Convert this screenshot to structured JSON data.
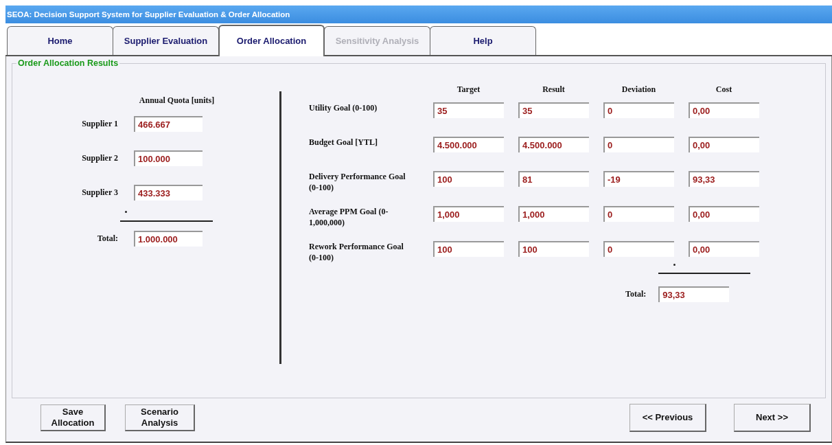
{
  "window": {
    "title": "SEOA: Decision Support System for Supplier Evaluation & Order Allocation"
  },
  "tabs": [
    {
      "label": "Home",
      "selected": false,
      "disabled": false
    },
    {
      "label": "Supplier Evaluation",
      "selected": false,
      "disabled": false
    },
    {
      "label": "Order Allocation",
      "selected": true,
      "disabled": false
    },
    {
      "label": "Sensitivity Analysis",
      "selected": false,
      "disabled": true
    },
    {
      "label": "Help",
      "selected": false,
      "disabled": false
    }
  ],
  "group": {
    "title": "Order Allocation Results"
  },
  "quota": {
    "heading": "Annual Quota [units]",
    "rows": [
      {
        "label": "Supplier 1",
        "value": "466.667"
      },
      {
        "label": "Supplier 2",
        "value": "100.000"
      },
      {
        "label": "Supplier 3",
        "value": "433.333"
      }
    ],
    "total_label": "Total:",
    "total": "1.000.000"
  },
  "goals": {
    "columns": [
      "Target",
      "Result",
      "Deviation",
      "Cost"
    ],
    "rows": [
      {
        "label": "Utility Goal   (0-100)",
        "values": [
          "35",
          "35",
          "0",
          "0,00"
        ]
      },
      {
        "label": "Budget Goal   [YTL]",
        "values": [
          "4.500.000",
          "4.500.000",
          "0",
          "0,00"
        ]
      },
      {
        "label": "Delivery Performance Goal  (0-100)",
        "values": [
          "100",
          "81",
          "-19",
          "93,33"
        ]
      },
      {
        "label": "Average PPM Goal (0-1,000,000)",
        "values": [
          "1,000",
          "1,000",
          "0",
          "0,00"
        ]
      },
      {
        "label": "Rework Performance Goal  (0-100)",
        "values": [
          "100",
          "100",
          "0",
          "0,00"
        ]
      }
    ],
    "total_label": "Total:",
    "total": "93,33"
  },
  "buttons_left": [
    {
      "label": "Save Allocation"
    },
    {
      "label": "Scenario Analysis"
    }
  ],
  "buttons_right": [
    {
      "label": "<< Previous"
    },
    {
      "label": "Next >>"
    }
  ]
}
